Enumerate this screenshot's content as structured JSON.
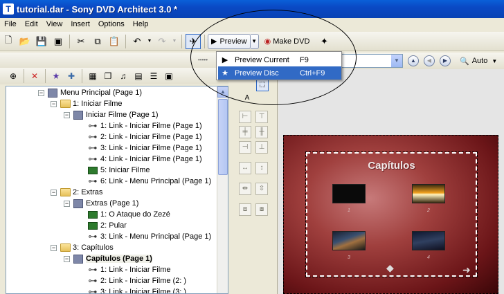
{
  "window": {
    "title": "tutorial.dar - Sony DVD Architect 3.0 *"
  },
  "menubar": {
    "items": [
      "File",
      "Edit",
      "View",
      "Insert",
      "Options",
      "Help"
    ]
  },
  "toolbar": {
    "preview_label": "Preview",
    "make_dvd_label": "Make DVD"
  },
  "preview_menu": {
    "items": [
      {
        "label": "Preview Current",
        "shortcut": "F9"
      },
      {
        "label": "Preview Disc",
        "shortcut": "Ctrl+F9"
      }
    ]
  },
  "zoom": {
    "label": "Auto"
  },
  "tree": [
    {
      "label": "Menu Principal (Page 1)"
    },
    {
      "label": "1: Iniciar Filme"
    },
    {
      "label": "Iniciar Filme (Page 1)"
    },
    {
      "label": "1: Link - Iniciar Filme (Page 1)"
    },
    {
      "label": "2: Link - Iniciar Filme (Page 1)"
    },
    {
      "label": "3: Link - Iniciar Filme (Page 1)"
    },
    {
      "label": "4: Link - Iniciar Filme (Page 1)"
    },
    {
      "label": "5: Iniciar Filme"
    },
    {
      "label": "6: Link - Menu Principal (Page 1)"
    },
    {
      "label": "2: Extras"
    },
    {
      "label": "Extras (Page 1)"
    },
    {
      "label": "1: O Ataque do Zezé"
    },
    {
      "label": "2: Pular"
    },
    {
      "label": "3: Link - Menu Principal (Page 1)"
    },
    {
      "label": "3: Capítulos"
    },
    {
      "label": "Capítulos (Page 1)"
    },
    {
      "label": "1: Link - Iniciar Filme"
    },
    {
      "label": "2: Link - Iniciar Filme (2: )"
    },
    {
      "label": "3: Link - Iniciar Filme (3: )"
    }
  ],
  "dvd_menu": {
    "title": "Capítulos",
    "thumb_numbers": [
      "1",
      "2",
      "3",
      "4"
    ]
  }
}
